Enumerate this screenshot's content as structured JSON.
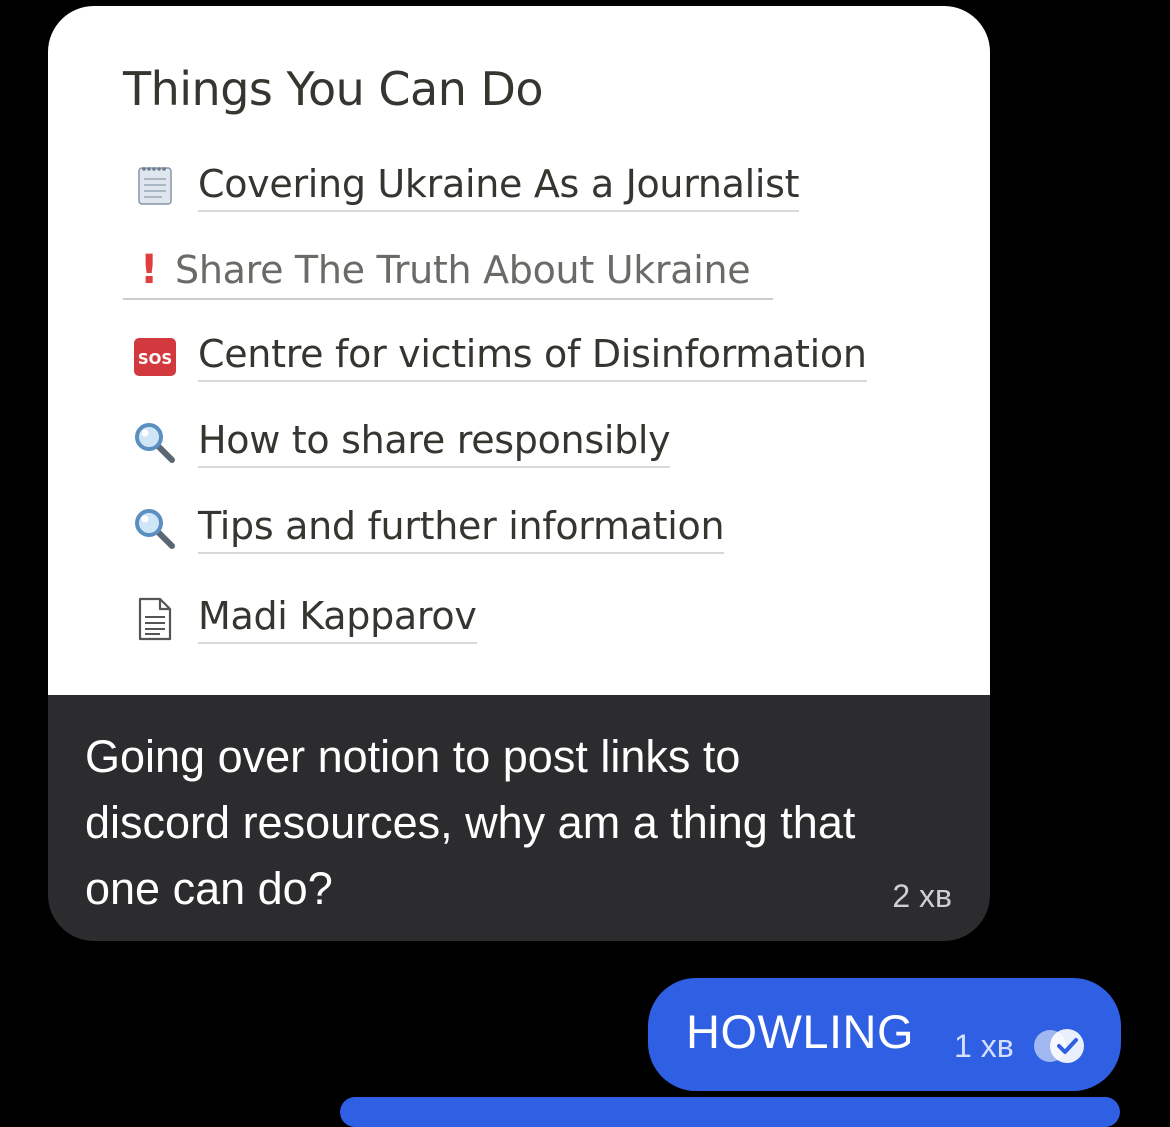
{
  "incoming": {
    "preview": {
      "title": "Things You Can Do",
      "items": [
        {
          "icon": "notepad-icon",
          "label": "Covering Ukraine As a Journalist"
        },
        {
          "icon": "exclamation-icon",
          "label": "Share The Truth About Ukraine",
          "mark": "!"
        },
        {
          "icon": "sos-icon",
          "label": "Centre for victims of Disinformation",
          "badge": "SOS"
        },
        {
          "icon": "magnifier-icon",
          "label": "How to share responsibly"
        },
        {
          "icon": "magnifier-icon",
          "label": "Tips and further information"
        },
        {
          "icon": "document-icon",
          "label": "Madi Kapparov"
        }
      ]
    },
    "text": "Going over notion to post links to discord resources, why am a thing that one can do?",
    "time": "2 хв"
  },
  "outgoing": {
    "text": "HOWLING",
    "time": "1 хв",
    "status": "read"
  },
  "colors": {
    "background": "#000000",
    "incoming_bubble": "#2c2c2e",
    "outgoing_bubble": "#2f5fe3",
    "preview_bg": "#ffffff",
    "link_text": "#37352f",
    "sos_red": "#d2393f"
  }
}
